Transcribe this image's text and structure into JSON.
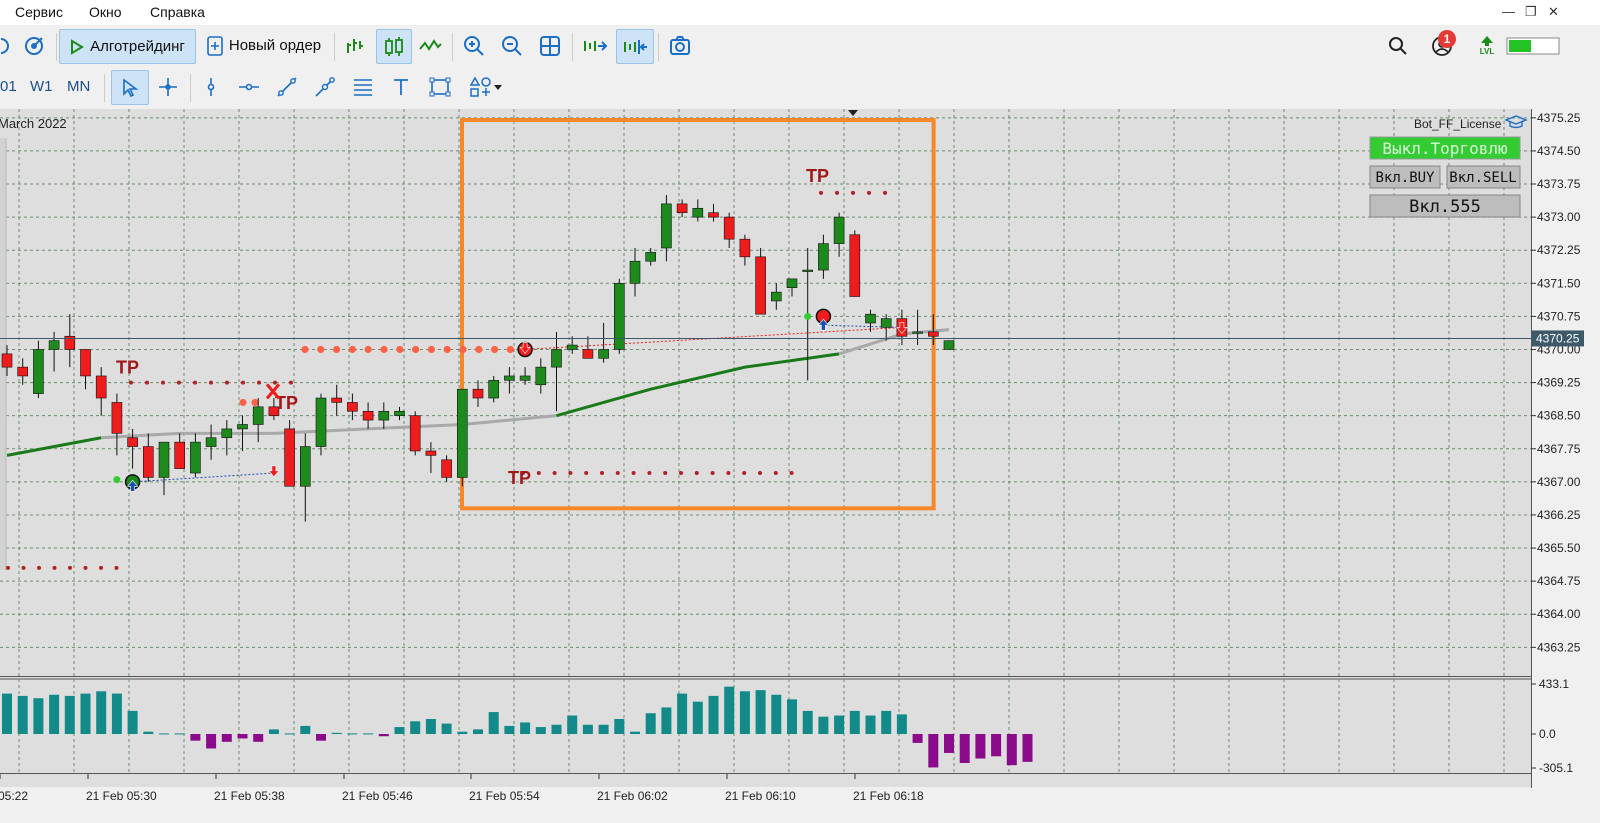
{
  "menu": {
    "items": [
      "Сервис",
      "Окно",
      "Справка"
    ]
  },
  "toolbar": {
    "algo_label": "Алготрейдинг",
    "new_order_label": "Новый ордер",
    "notification_count": "1",
    "lvl_label": "LVL"
  },
  "timeframes": [
    "01",
    "W1",
    "MN"
  ],
  "chart": {
    "header_date": "March 2022",
    "ea_name": "Bot_FF_License",
    "buttons": {
      "toggle_trading": "Выкл.Торговлю",
      "buy": "Вкл.BUY",
      "sell": "Вкл.SELL",
      "magic": "Вкл.555"
    },
    "current_price": "4370.25",
    "tp_label": "TP",
    "highlight_color": "#f5882a",
    "bull_color": "#1e8a1e",
    "bear_color": "#ee1c1c",
    "hist_pos_color": "#138a8a",
    "hist_neg_color": "#8b0a8b"
  },
  "chart_data": {
    "type": "candlestick",
    "price_axis": {
      "ticks": [
        "4375.25",
        "4374.50",
        "4373.75",
        "4373.00",
        "4372.25",
        "4371.50",
        "4370.75",
        "4370.00",
        "4369.25",
        "4368.50",
        "4367.75",
        "4367.00",
        "4366.25",
        "4365.50",
        "4364.75",
        "4364.00",
        "4363.25"
      ],
      "ylim": [
        4362.6,
        4375.45
      ]
    },
    "time_axis": {
      "labels": [
        "05:22",
        "21 Feb 05:30",
        "21 Feb 05:38",
        "21 Feb 05:46",
        "21 Feb 05:54",
        "21 Feb 06:02",
        "21 Feb 06:10",
        "21 Feb 06:18"
      ]
    },
    "candles": [
      [
        4369.9,
        4370.1,
        4369.4,
        4369.6
      ],
      [
        4369.6,
        4369.8,
        4369.2,
        4369.4
      ],
      [
        4369.0,
        4370.2,
        4368.9,
        4370.0
      ],
      [
        4370.0,
        4370.4,
        4369.5,
        4370.2
      ],
      [
        4370.3,
        4370.8,
        4369.6,
        4370.0
      ],
      [
        4370.0,
        4370.0,
        4369.1,
        4369.4
      ],
      [
        4369.4,
        4369.6,
        4368.5,
        4368.9
      ],
      [
        4368.8,
        4369.0,
        4367.6,
        4368.1
      ],
      [
        4368.0,
        4368.2,
        4367.3,
        4367.8
      ],
      [
        4367.8,
        4368.1,
        4367.0,
        4367.1
      ],
      [
        4367.1,
        4367.9,
        4366.7,
        4367.9
      ],
      [
        4367.9,
        4368.1,
        4367.3,
        4367.3
      ],
      [
        4367.2,
        4368.1,
        4367.1,
        4367.9
      ],
      [
        4367.8,
        4368.3,
        4367.5,
        4368.0
      ],
      [
        4368.0,
        4368.4,
        4367.6,
        4368.2
      ],
      [
        4368.2,
        4368.5,
        4367.7,
        4368.3
      ],
      [
        4368.3,
        4368.9,
        4367.9,
        4368.7
      ],
      [
        4368.7,
        4368.9,
        4368.4,
        4368.5
      ],
      [
        4368.2,
        4368.4,
        4366.9,
        4366.9
      ],
      [
        4366.9,
        4368.1,
        4366.1,
        4367.8
      ],
      [
        4367.8,
        4369.0,
        4367.6,
        4368.9
      ],
      [
        4368.9,
        4369.2,
        4368.5,
        4368.8
      ],
      [
        4368.8,
        4369.0,
        4368.4,
        4368.6
      ],
      [
        4368.6,
        4368.8,
        4368.2,
        4368.4
      ],
      [
        4368.4,
        4368.8,
        4368.2,
        4368.6
      ],
      [
        4368.5,
        4368.7,
        4368.4,
        4368.6
      ],
      [
        4368.5,
        4368.6,
        4367.6,
        4367.7
      ],
      [
        4367.7,
        4367.9,
        4367.2,
        4367.6
      ],
      [
        4367.5,
        4367.6,
        4367.0,
        4367.1
      ],
      [
        4367.1,
        4369.1,
        4366.9,
        4369.1
      ],
      [
        4369.1,
        4369.3,
        4368.7,
        4368.9
      ],
      [
        4368.9,
        4369.4,
        4368.8,
        4369.3
      ],
      [
        4369.3,
        4369.6,
        4369.0,
        4369.4
      ],
      [
        4369.3,
        4369.6,
        4369.2,
        4369.4
      ],
      [
        4369.2,
        4369.8,
        4369.0,
        4369.6
      ],
      [
        4369.6,
        4370.4,
        4368.6,
        4370.0
      ],
      [
        4370.0,
        4370.3,
        4369.9,
        4370.1
      ],
      [
        4370.0,
        4370.3,
        4369.8,
        4369.8
      ],
      [
        4369.8,
        4370.6,
        4369.7,
        4370.0
      ],
      [
        4370.0,
        4371.6,
        4369.9,
        4371.5
      ],
      [
        4371.5,
        4372.3,
        4371.2,
        4372.0
      ],
      [
        4372.0,
        4372.3,
        4371.9,
        4372.2
      ],
      [
        4372.3,
        4373.5,
        4372.0,
        4373.3
      ],
      [
        4373.3,
        4373.4,
        4373.0,
        4373.1
      ],
      [
        4373.0,
        4373.4,
        4372.9,
        4373.2
      ],
      [
        4373.1,
        4373.3,
        4372.9,
        4373.0
      ],
      [
        4373.0,
        4373.1,
        4372.3,
        4372.5
      ],
      [
        4372.5,
        4372.6,
        4371.9,
        4372.1
      ],
      [
        4372.1,
        4372.3,
        4370.8,
        4370.8
      ],
      [
        4371.1,
        4371.5,
        4370.9,
        4371.3
      ],
      [
        4371.4,
        4371.6,
        4371.2,
        4371.6
      ],
      [
        4371.8,
        4372.3,
        4369.3,
        4371.8
      ],
      [
        4371.8,
        4372.6,
        4371.6,
        4372.4
      ],
      [
        4372.4,
        4373.1,
        4372.1,
        4373.0
      ],
      [
        4372.6,
        4372.7,
        4371.2,
        4371.2
      ],
      [
        4370.6,
        4370.9,
        4370.4,
        4370.8
      ],
      [
        4370.5,
        4370.8,
        4370.2,
        4370.7
      ],
      [
        4370.7,
        4370.9,
        4370.1,
        4370.3
      ],
      [
        4370.4,
        4370.9,
        4370.1,
        4370.4
      ],
      [
        4370.4,
        4370.8,
        4370.1,
        4370.3
      ],
      [
        4370.0,
        4370.2,
        4370.0,
        4370.2
      ]
    ],
    "moving_average": [
      [
        0,
        4367.6
      ],
      [
        6,
        4368.0
      ],
      [
        11,
        4368.1
      ],
      [
        17,
        4368.1
      ],
      [
        23,
        4368.2
      ],
      [
        29,
        4368.3
      ],
      [
        35,
        4368.5
      ],
      [
        41,
        4369.1
      ],
      [
        47,
        4369.6
      ],
      [
        53,
        4369.9
      ],
      [
        57,
        4370.35
      ],
      [
        60,
        4370.45
      ]
    ],
    "tp_levels": [
      {
        "label": "TP",
        "price": 4369.25
      },
      {
        "label": "TP",
        "price": 4368.6
      },
      {
        "label": "TP",
        "price": 4367.2
      },
      {
        "label": "TP",
        "price": 4373.55
      }
    ],
    "histogram": {
      "scale_labels": [
        "433.1",
        "0.0",
        "-305.1"
      ],
      "ylim": [
        -305.1,
        433.1
      ],
      "values": [
        350,
        330,
        310,
        340,
        330,
        350,
        370,
        350,
        200,
        20,
        5,
        5,
        -60,
        -130,
        -70,
        -40,
        -70,
        40,
        5,
        70,
        -60,
        10,
        5,
        5,
        -20,
        60,
        110,
        130,
        90,
        20,
        40,
        190,
        70,
        100,
        60,
        80,
        160,
        80,
        80,
        130,
        20,
        180,
        230,
        350,
        280,
        330,
        410,
        370,
        380,
        340,
        300,
        200,
        150,
        160,
        200,
        160,
        200,
        170,
        -80,
        -300,
        -170,
        -260,
        -220,
        -200,
        -280,
        -250
      ]
    },
    "highlight_region": {
      "from_index": 30,
      "to_index": 58,
      "price_high": 4375.2,
      "price_low": 4366.4
    }
  }
}
